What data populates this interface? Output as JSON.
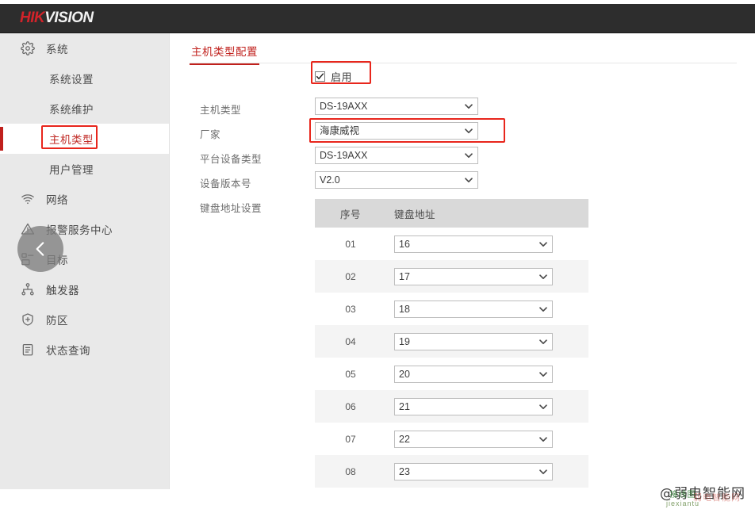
{
  "header": {
    "logo_hik": "HIK",
    "logo_vision": "VISION"
  },
  "sidebar": {
    "items": [
      {
        "label": "系统",
        "icon": "gear-icon",
        "level": "group",
        "active": false
      },
      {
        "label": "系统设置",
        "icon": "",
        "level": "sub",
        "active": false
      },
      {
        "label": "系统维护",
        "icon": "",
        "level": "sub",
        "active": false
      },
      {
        "label": "主机类型",
        "icon": "",
        "level": "sub",
        "active": true
      },
      {
        "label": "用户管理",
        "icon": "",
        "level": "sub",
        "active": false
      },
      {
        "label": "网络",
        "icon": "wifi-icon",
        "level": "group",
        "active": false
      },
      {
        "label": "报警服务中心",
        "icon": "warning-triangle-icon",
        "level": "group",
        "active": false
      },
      {
        "label": "目标",
        "icon": "target-device-icon",
        "level": "group",
        "active": false
      },
      {
        "label": "触发器",
        "icon": "nodes-icon",
        "level": "group",
        "active": false
      },
      {
        "label": "防区",
        "icon": "shield-plus-icon",
        "level": "group",
        "active": false
      },
      {
        "label": "状态查询",
        "icon": "clipboard-icon",
        "level": "group",
        "active": false
      }
    ],
    "collapse_icon": "chevron-left-icon"
  },
  "main": {
    "tab_label": "主机类型配置",
    "enable": {
      "label": "启用",
      "checked": true
    },
    "fields": [
      {
        "label": "主机类型",
        "value": "DS-19AXX"
      },
      {
        "label": "厂家",
        "value": "海康威视"
      },
      {
        "label": "平台设备类型",
        "value": "DS-19AXX"
      },
      {
        "label": "设备版本号",
        "value": "V2.0"
      }
    ],
    "table_label": "键盘地址设置",
    "table": {
      "columns": [
        "序号",
        "键盘地址"
      ],
      "rows": [
        {
          "no": "01",
          "addr": "16"
        },
        {
          "no": "02",
          "addr": "17"
        },
        {
          "no": "03",
          "addr": "18"
        },
        {
          "no": "04",
          "addr": "19"
        },
        {
          "no": "05",
          "addr": "20"
        },
        {
          "no": "06",
          "addr": "21"
        },
        {
          "no": "07",
          "addr": "22"
        },
        {
          "no": "08",
          "addr": "23"
        }
      ]
    }
  },
  "watermark": {
    "text": "@弱电智能网",
    "sub_cn": "接线图",
    "sub_py": "jiexiantu",
    "stamp": "弱电智能网"
  },
  "colors": {
    "brand_red": "#d2232a",
    "accent_red": "#c0201c",
    "annotation_red": "#e8261c",
    "header_bg": "#2d2d2d",
    "sidebar_bg": "#e9e9e9",
    "table_head_bg": "#d9d9d9",
    "row_alt_bg": "#f4f4f4"
  }
}
